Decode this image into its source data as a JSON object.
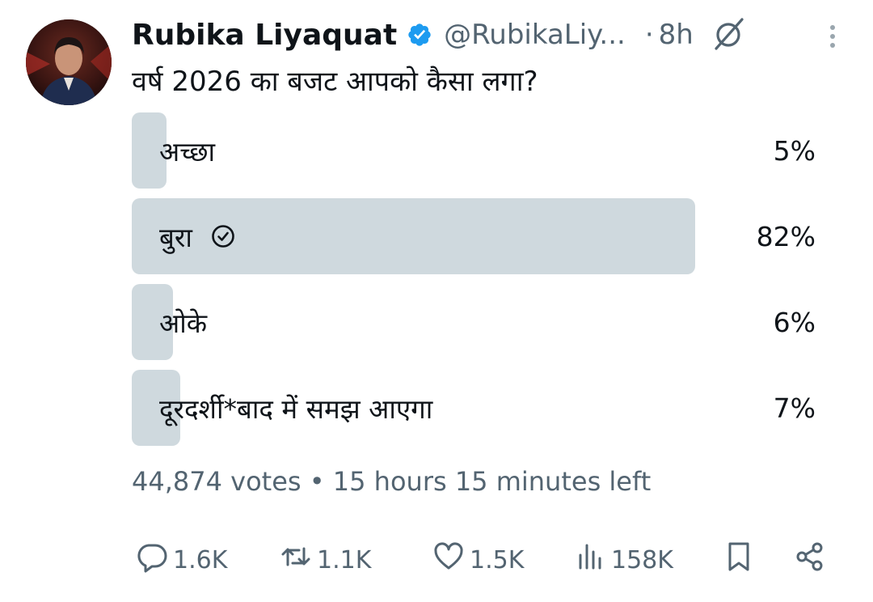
{
  "author": {
    "name": "Rubika Liyaquat",
    "handle": "@RubikaLiy...",
    "separator": "·",
    "time": "8h"
  },
  "question": "वर्ष 2026 का बजट आपको कैसा लगा?",
  "poll": {
    "options": [
      {
        "label": "अच्छा",
        "percent_text": "5%",
        "percent": 5,
        "selected": false
      },
      {
        "label": "बुरा",
        "percent_text": "82%",
        "percent": 82,
        "selected": true
      },
      {
        "label": "ओके",
        "percent_text": "6%",
        "percent": 6,
        "selected": false
      },
      {
        "label": "दूरदर्शी*बाद में समझ आएगा",
        "percent_text": "7%",
        "percent": 7,
        "selected": false
      }
    ],
    "meta": "44,874 votes • 15 hours 15 minutes left"
  },
  "actions": {
    "replies": "1.6K",
    "reposts": "1.1K",
    "likes": "1.5K",
    "views": "158K"
  },
  "colors": {
    "bar_fill": "#cfd9de",
    "muted_text": "#536471",
    "verified": "#1d9bf0"
  },
  "icons": {
    "verified": "verified-badge-icon",
    "grok": "grok-icon",
    "more": "more-icon",
    "check": "check-circle-icon",
    "reply": "reply-icon",
    "repost": "repost-icon",
    "like": "heart-icon",
    "views": "views-icon",
    "bookmark": "bookmark-icon",
    "share": "share-icon"
  }
}
